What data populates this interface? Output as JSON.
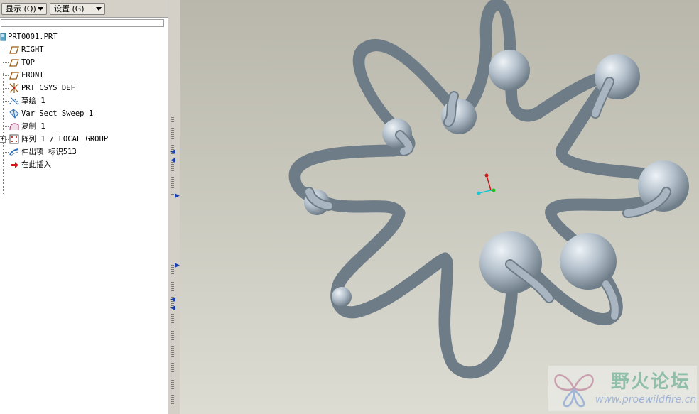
{
  "toolbar": {
    "display_label": "显示 (Q)",
    "settings_label": "设置 (G)"
  },
  "model_tree": {
    "root": "PRT0001.PRT",
    "items": [
      {
        "label": "RIGHT",
        "icon": "datum-plane-icon"
      },
      {
        "label": "TOP",
        "icon": "datum-plane-icon"
      },
      {
        "label": "FRONT",
        "icon": "datum-plane-icon"
      },
      {
        "label": "PRT_CSYS_DEF",
        "icon": "coordinate-system-icon"
      },
      {
        "label": "草绘 1",
        "icon": "sketch-icon"
      },
      {
        "label": "Var Sect Sweep 1",
        "icon": "sweep-icon"
      },
      {
        "label": "复制 1",
        "icon": "copy-icon"
      },
      {
        "label": "阵列 1 / LOCAL_GROUP",
        "icon": "pattern-icon"
      },
      {
        "label": "伸出项 标识513",
        "icon": "protrusion-icon"
      },
      {
        "label": "在此插入",
        "icon": "insert-here-arrow-icon"
      }
    ]
  },
  "colors": {
    "tube": "#a9b6c2",
    "tube_dark": "#6e7c88",
    "tube_light": "#e6edf3",
    "background_top": "#b9b7ab",
    "background_bottom": "#dcdcd3"
  },
  "watermark": {
    "title": "野火论坛",
    "url": "www.proewildfire.cn"
  }
}
